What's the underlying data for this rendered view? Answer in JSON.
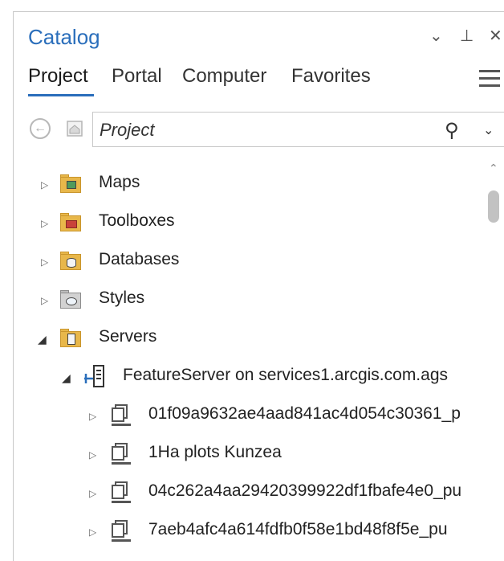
{
  "window": {
    "title": "Catalog",
    "chevron_glyph": "⌄",
    "pin_glyph": "⊥",
    "close_glyph": "✕"
  },
  "tabs": [
    {
      "label": "Project",
      "active": true
    },
    {
      "label": "Portal",
      "active": false
    },
    {
      "label": "Computer",
      "active": false
    },
    {
      "label": "Favorites",
      "active": false
    }
  ],
  "nav": {
    "back_glyph": "←",
    "search_value": "",
    "search_placeholder": "Project",
    "search_glyph": "⚲",
    "dropdown_glyph": "⌄"
  },
  "tree": {
    "items": [
      {
        "label": "Maps",
        "icon": "maps-folder-icon",
        "expanded": false
      },
      {
        "label": "Toolboxes",
        "icon": "toolboxes-folder-icon",
        "expanded": false
      },
      {
        "label": "Databases",
        "icon": "databases-folder-icon",
        "expanded": false
      },
      {
        "label": "Styles",
        "icon": "styles-folder-icon",
        "expanded": false
      },
      {
        "label": "Servers",
        "icon": "servers-folder-icon",
        "expanded": true
      },
      {
        "label": "FeatureServer on services1.arcgis.com.ags",
        "icon": "feature-server-icon",
        "expanded": true
      },
      {
        "label": "01f09a9632ae4aad841ac4d054c30361_p",
        "icon": "feature-service-icon",
        "expanded": false
      },
      {
        "label": "1Ha plots Kunzea",
        "icon": "feature-service-icon",
        "expanded": false
      },
      {
        "label": "04c262a4aa29420399922df1fbafe4e0_pu",
        "icon": "feature-service-icon",
        "expanded": false
      },
      {
        "label": "7aeb4afc4a614fdfb0f58e1bd48f8f5e_pu",
        "icon": "feature-service-icon",
        "expanded": false
      }
    ],
    "collapsed_glyph": "▷",
    "expanded_glyph": "◢"
  },
  "colors": {
    "accent": "#2a6ebb",
    "folder": "#e8b74a"
  },
  "scroll": {
    "up_glyph": "⌃"
  }
}
